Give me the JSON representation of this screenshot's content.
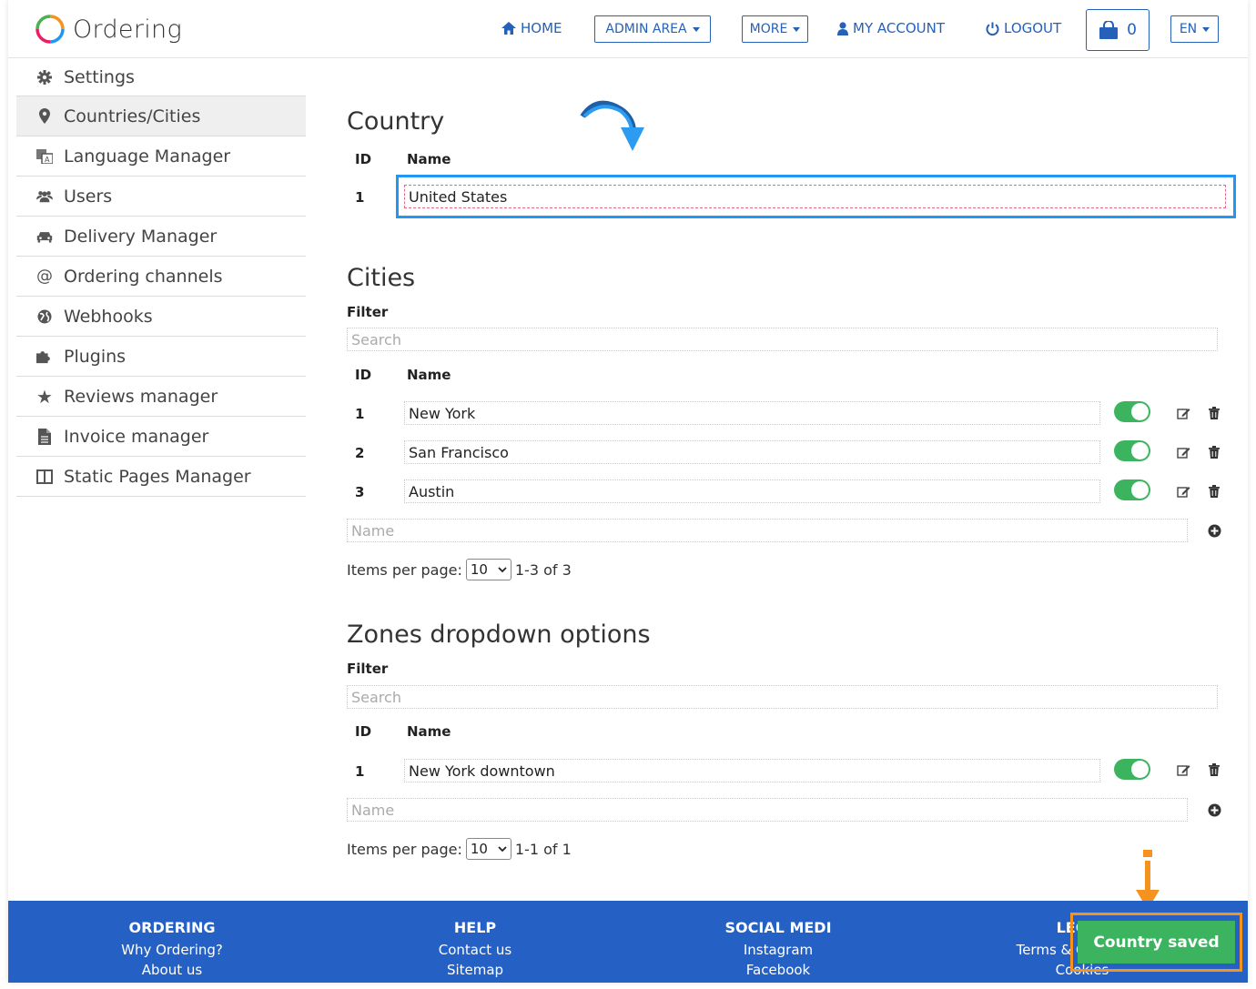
{
  "app": {
    "name": "Ordering"
  },
  "nav": {
    "home": "HOME",
    "admin": "ADMIN AREA",
    "more": "MORE",
    "account": "MY ACCOUNT",
    "logout": "LOGOUT",
    "cart_count": "0",
    "lang": "EN"
  },
  "sidebar": {
    "items": [
      {
        "label": "Settings",
        "icon": "gear-icon"
      },
      {
        "label": "Countries/Cities",
        "icon": "map-marker-icon"
      },
      {
        "label": "Language Manager",
        "icon": "language-icon"
      },
      {
        "label": "Users",
        "icon": "users-icon"
      },
      {
        "label": "Delivery Manager",
        "icon": "car-icon"
      },
      {
        "label": "Ordering channels",
        "icon": "at-icon"
      },
      {
        "label": "Webhooks",
        "icon": "globe-icon"
      },
      {
        "label": "Plugins",
        "icon": "puzzle-icon"
      },
      {
        "label": "Reviews manager",
        "icon": "star-icon"
      },
      {
        "label": "Invoice manager",
        "icon": "file-icon"
      },
      {
        "label": "Static Pages Manager",
        "icon": "columns-icon"
      }
    ]
  },
  "country": {
    "title": "Country",
    "col_id": "ID",
    "col_name": "Name",
    "rows": [
      {
        "id": "1",
        "name": "United States"
      }
    ]
  },
  "cities": {
    "title": "Cities",
    "filter_label": "Filter",
    "search_placeholder": "Search",
    "col_id": "ID",
    "col_name": "Name",
    "rows": [
      {
        "id": "1",
        "name": "New York",
        "enabled": true
      },
      {
        "id": "2",
        "name": "San Francisco",
        "enabled": true
      },
      {
        "id": "3",
        "name": "Austin",
        "enabled": true
      }
    ],
    "new_placeholder": "Name",
    "pager_label": "Items per page:",
    "per_page": "10",
    "range": "1-3 of 3"
  },
  "zones": {
    "title": "Zones dropdown options",
    "filter_label": "Filter",
    "search_placeholder": "Search",
    "col_id": "ID",
    "col_name": "Name",
    "rows": [
      {
        "id": "1",
        "name": "New York downtown",
        "enabled": true
      }
    ],
    "new_placeholder": "Name",
    "pager_label": "Items per page:",
    "per_page": "10",
    "range": "1-1 of 1"
  },
  "footer": {
    "cols": [
      {
        "head": "ORDERING",
        "links": [
          "Why Ordering?",
          "About us"
        ]
      },
      {
        "head": "HELP",
        "links": [
          "Contact us",
          "Sitemap"
        ]
      },
      {
        "head": "SOCIAL MEDI",
        "links": [
          "Instagram",
          "Facebook"
        ]
      },
      {
        "head": "LEGAL",
        "links": [
          "Terms & Conditions",
          "Cookies"
        ]
      }
    ]
  },
  "toast": {
    "message": "Country saved"
  },
  "colors": {
    "brand": "#2560c4",
    "success": "#3cb45f",
    "highlight": "#2196f3",
    "annotation": "#f6921e"
  }
}
